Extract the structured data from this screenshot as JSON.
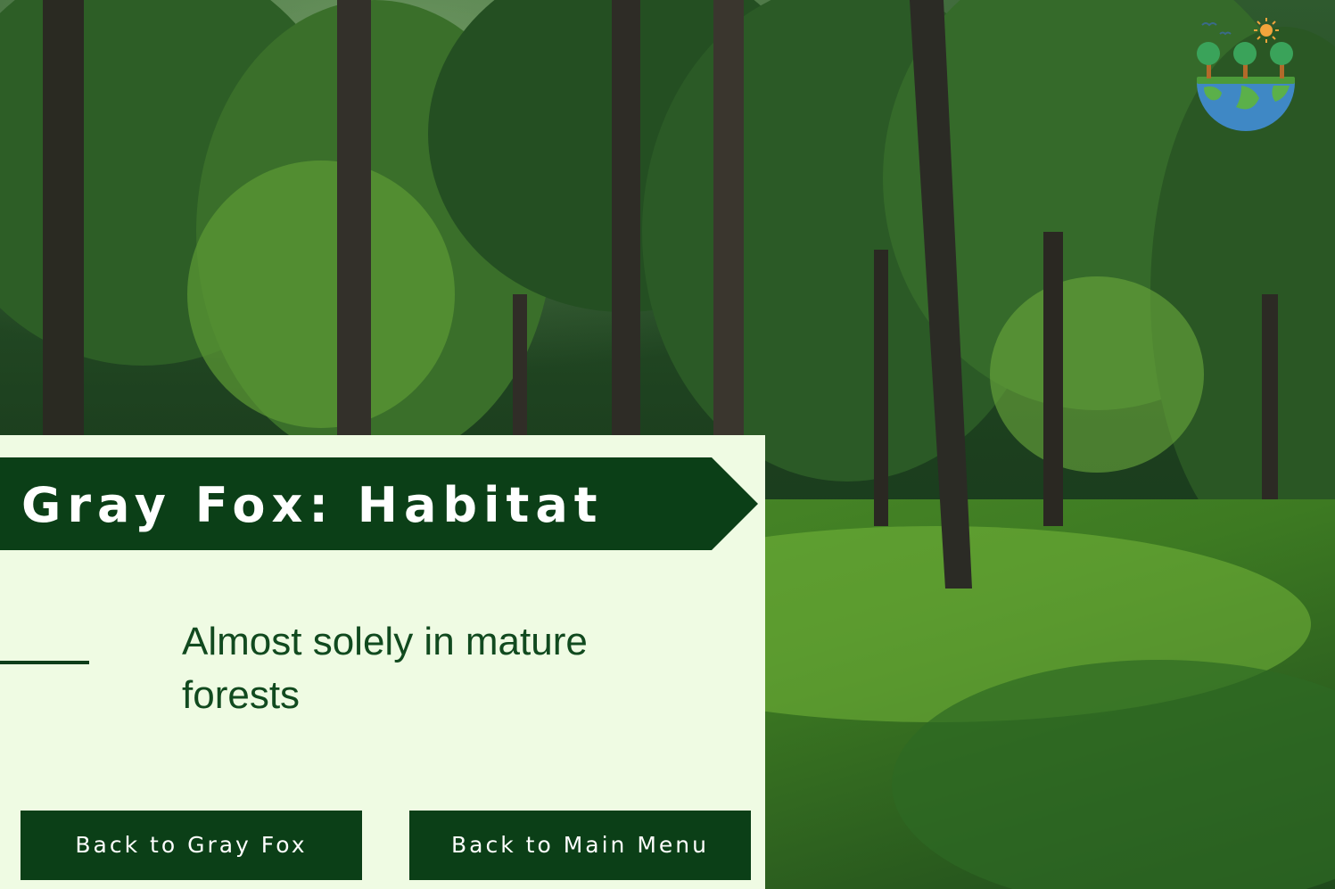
{
  "slide": {
    "title": "Gray Fox: Habitat",
    "body_text": "Almost solely in mature forests"
  },
  "buttons": {
    "back_to_fox": "Back to Gray Fox",
    "back_to_menu": "Back to Main Menu"
  },
  "background": {
    "icon": "forest-photo"
  },
  "logo": {
    "icon": "earth-trees-sun-logo"
  },
  "colors": {
    "panel_bg": "#effbe3",
    "banner_bg": "#0b3f17",
    "body_text": "#114a1f",
    "button_bg": "#0b3f17",
    "button_text": "#ffffff"
  }
}
